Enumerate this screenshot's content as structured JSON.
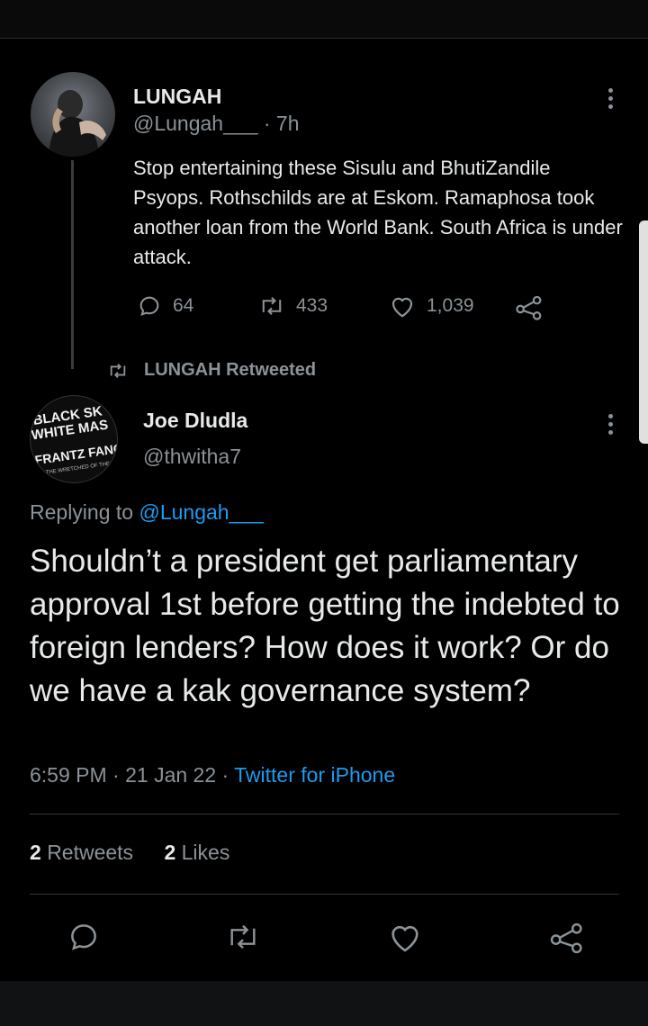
{
  "original_tweet": {
    "name": "LUNGAH",
    "handle": "@Lungah___",
    "time": "· 7h",
    "text": "Stop entertaining these Sisulu and BhutiZandile Psyops. Rothschilds are at Eskom. Ramaphosa took another loan from the World Bank. South Africa is under attack.",
    "replies": "64",
    "retweets": "433",
    "likes": "1,039"
  },
  "retweet_label": "LUNGAH Retweeted",
  "reply_tweet": {
    "name": "Joe Dludla",
    "handle": "@thwitha7",
    "replying_prefix": "Replying to ",
    "replying_mention": "@Lungah___",
    "text": "Shouldn’t a president get parliamentary approval 1st before getting the indebted to foreign lenders? How does it work? Or do we have a kak governance system?",
    "time": "6:59 PM · 21 Jan 22 · ",
    "source": "Twitter for iPhone",
    "retweet_count": "2",
    "retweet_word": "Retweets",
    "like_count": "2",
    "like_word": "Likes"
  },
  "avatar2_text": [
    "BLACK SK",
    "WHITE MAS",
    "FRANTZ FANON",
    "THE WRETCHED OF THE"
  ],
  "colors": {
    "background": "#000000",
    "text": "#e7e9ea",
    "muted": "#8b9298",
    "link": "#1d9bf0",
    "divider": "#2f3336"
  }
}
